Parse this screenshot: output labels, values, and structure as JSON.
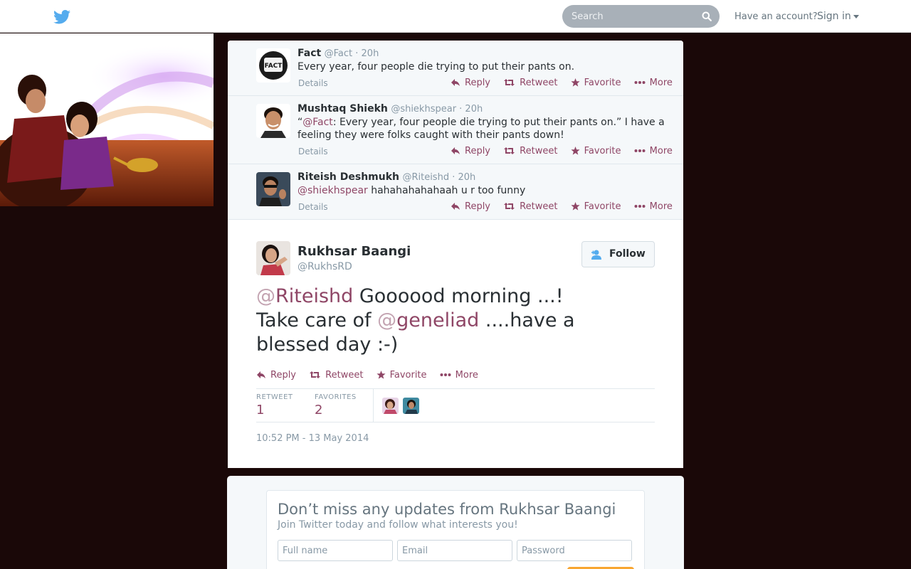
{
  "topbar": {
    "search_placeholder": "Search",
    "have_account": "Have an account?",
    "sign_in": "Sign in"
  },
  "ancestors": [
    {
      "name": "Fact",
      "meta": "@Fact · 20h",
      "text_parts": [
        "Every year, four people die trying to put their pants on."
      ],
      "details": "Details"
    },
    {
      "name": "Mushtaq Shiekh",
      "meta": "@shiekhspear · 20h",
      "text_quote_open": "“",
      "text_mention": "@Fact",
      "text_rest": ": Every year, four people die trying to put their pants on.”  I have a feeling they were folks caught with their pants down!",
      "details": "Details"
    },
    {
      "name": "Riteish Deshmukh",
      "meta": "@Riteishd · 20h",
      "text_mention": "@shiekhspear",
      "text_rest": " hahahahahahaah u r too funny",
      "details": "Details"
    }
  ],
  "actions": {
    "reply": "Reply",
    "retweet": "Retweet",
    "favorite": "Favorite",
    "more": "More"
  },
  "main_tweet": {
    "name": "Rukhsar Baangi",
    "handle": "@RukhsRD",
    "follow_label": "Follow",
    "at_sign_1": "@",
    "mention_1": "Riteishd",
    "text_1": " Goooood morning ...!",
    "text_2": "Take care of ",
    "at_sign_2": "@",
    "mention_2": "geneliad",
    "text_3": " ....have a",
    "text_4": "blessed day :-)",
    "retweet_label": "RETWEET",
    "retweet_count": "1",
    "favorites_label": "FAVORITES",
    "favorites_count": "2",
    "timestamp": "10:52 PM - 13 May 2014"
  },
  "signup": {
    "title": "Don’t miss any updates from Rukhsar Baangi",
    "subtitle": "Join Twitter today and follow what interests you!",
    "fullname_placeholder": "Full name",
    "email_placeholder": "Email",
    "password_placeholder": "Password"
  },
  "colors": {
    "link": "#8f4666",
    "background": "#1a0808",
    "twitter_blue": "#55acee"
  }
}
